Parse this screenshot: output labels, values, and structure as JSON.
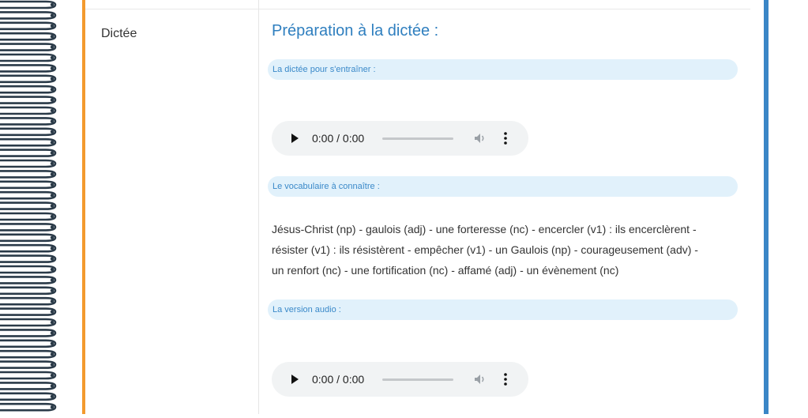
{
  "row": {
    "label": "Dictée"
  },
  "main": {
    "title": "Préparation à la dictée :",
    "sections": [
      {
        "label": "La dictée pour s'entraîner :"
      },
      {
        "label": "Le vocabulaire à connaître :"
      },
      {
        "label": "La version audio :"
      }
    ],
    "vocab_lines": [
      "Jésus-Christ (np) - gaulois (adj) - une forteresse (nc) - encercler (v1) : ils encerclèrent -",
      "résister (v1) : ils résistèrent - empêcher (v1) - un Gaulois (np) - courageusement (adv) -",
      "un renfort (nc) - une fortification (nc) - affamé (adj) - un évènement (nc)"
    ],
    "audio_players": [
      {
        "time": "0:00 / 0:00",
        "progress": 0
      },
      {
        "time": "0:00 / 0:00",
        "progress": 0
      }
    ]
  },
  "colors": {
    "accent_blue": "#2f7fbf",
    "orange_border": "#f39a2e",
    "right_border": "#3a86c6",
    "pill_bg": "#e1f1fb"
  }
}
